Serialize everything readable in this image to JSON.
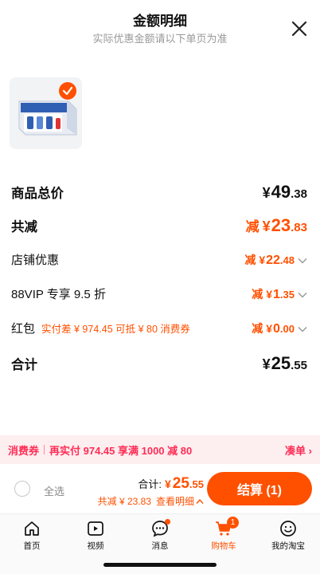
{
  "sheet": {
    "title": "金额明细",
    "subtitle": "实际优惠金额请以下单页为准"
  },
  "rows": {
    "goods_total": {
      "label": "商品总价",
      "yen": "¥",
      "int": "49",
      "dec": ".38"
    },
    "total_discount": {
      "label": "共减",
      "minus": "减",
      "yen": "¥",
      "int": "23",
      "dec": ".83"
    },
    "shop_discount": {
      "label": "店铺优惠",
      "minus": "减",
      "yen": "¥",
      "int": "22",
      "dec": ".48"
    },
    "vip": {
      "label": "88VIP 专享 9.5 折",
      "minus": "减",
      "yen": "¥",
      "int": "1",
      "dec": ".35"
    },
    "redbag": {
      "label": "红包",
      "note": "实付差 ¥ 974.45 可抵 ¥ 80 消费券",
      "minus": "减",
      "yen": "¥",
      "int": "0",
      "dec": ".00"
    },
    "subtotal": {
      "label": "合计",
      "yen": "¥",
      "int": "25",
      "dec": ".55"
    }
  },
  "coupon_bar": {
    "tag": "消费券",
    "text": "再实付 974.45 享满 1000 减 80",
    "link": "凑单 ›"
  },
  "checkout": {
    "select_all": "全选",
    "total_label": "合计:",
    "yen": "¥",
    "int": "25",
    "dec": ".55",
    "discount": "共减 ¥ 23.83",
    "detail_link": "查看明细",
    "settle": "结算 (1)"
  },
  "tabbar": {
    "items": [
      {
        "label": "首页",
        "icon": "home-icon"
      },
      {
        "label": "视频",
        "icon": "video-icon"
      },
      {
        "label": "消息",
        "icon": "message-icon"
      },
      {
        "label": "购物车",
        "icon": "cart-icon",
        "badge": "1"
      },
      {
        "label": "我的淘宝",
        "icon": "profile-icon"
      }
    ]
  },
  "colors": {
    "accent": "#ff5000",
    "coupon": "#ff2d55",
    "coupon_bg": "#fdeef0"
  }
}
